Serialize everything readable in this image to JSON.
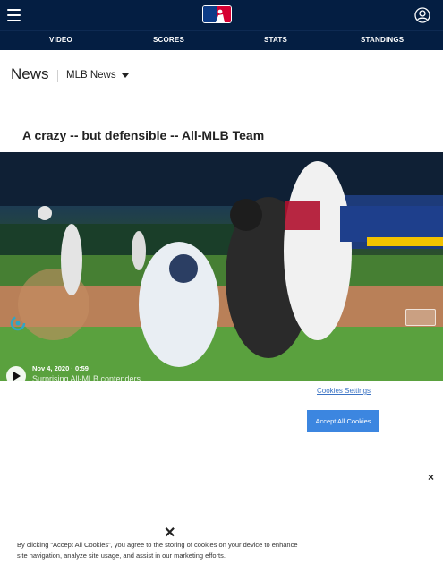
{
  "header": {
    "nav_tabs": [
      "VIDEO",
      "SCORES",
      "STATS",
      "STANDINGS"
    ]
  },
  "section": {
    "title": "News",
    "dropdown_label": "MLB News"
  },
  "article": {
    "headline": "A crazy -- but defensible -- All-MLB Team"
  },
  "video": {
    "date_duration": "Nov 4, 2020 · 0:59",
    "caption": "Surprising All-MLB contenders"
  },
  "cookie_banner": {
    "settings_link": "Cookies Settings",
    "accept_button": "Accept All Cookies",
    "close_glyph": "×",
    "main_close_glyph": "✕",
    "message": "By clicking “Accept All Cookies”, you agree to the storing of cookies on your device to enhance site navigation, analyze site usage, and assist in our marketing efforts."
  },
  "colors": {
    "header_bg": "#041e42",
    "accept_bg": "#3c86e0",
    "link": "#3b73c4"
  },
  "icons": [
    "menu-icon",
    "mlb-logo",
    "user-account-icon",
    "caret-down-icon",
    "loading-spinner-icon",
    "play-icon",
    "close-icon"
  ]
}
